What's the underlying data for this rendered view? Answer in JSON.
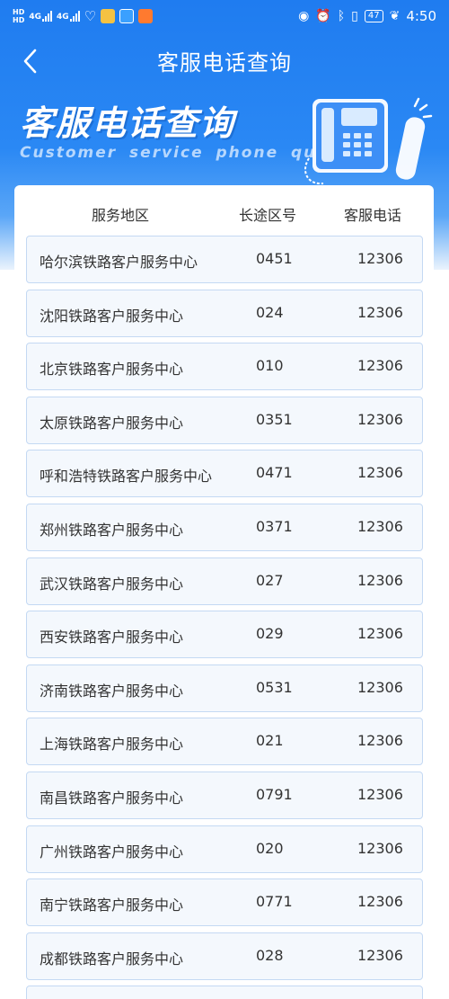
{
  "status_bar": {
    "hd_top": "HD",
    "hd_bottom": "HD",
    "net1": "4G",
    "net2": "4G",
    "battery": "47",
    "time": "4:50"
  },
  "nav": {
    "title": "客服电话查询"
  },
  "banner": {
    "title": "客服电话查询",
    "subtitle": "Customer service phone query"
  },
  "table": {
    "headers": {
      "region": "服务地区",
      "area_code": "长途区号",
      "phone": "客服电话"
    },
    "rows": [
      {
        "region": "哈尔滨铁路客户服务中心",
        "area_code": "0451",
        "phone": "12306"
      },
      {
        "region": "沈阳铁路客户服务中心",
        "area_code": "024",
        "phone": "12306"
      },
      {
        "region": "北京铁路客户服务中心",
        "area_code": "010",
        "phone": "12306"
      },
      {
        "region": "太原铁路客户服务中心",
        "area_code": "0351",
        "phone": "12306"
      },
      {
        "region": "呼和浩特铁路客户服务中心",
        "area_code": "0471",
        "phone": "12306"
      },
      {
        "region": "郑州铁路客户服务中心",
        "area_code": "0371",
        "phone": "12306"
      },
      {
        "region": "武汉铁路客户服务中心",
        "area_code": "027",
        "phone": "12306"
      },
      {
        "region": "西安铁路客户服务中心",
        "area_code": "029",
        "phone": "12306"
      },
      {
        "region": "济南铁路客户服务中心",
        "area_code": "0531",
        "phone": "12306"
      },
      {
        "region": "上海铁路客户服务中心",
        "area_code": "021",
        "phone": "12306"
      },
      {
        "region": "南昌铁路客户服务中心",
        "area_code": "0791",
        "phone": "12306"
      },
      {
        "region": "广州铁路客户服务中心",
        "area_code": "020",
        "phone": "12306"
      },
      {
        "region": "南宁铁路客户服务中心",
        "area_code": "0771",
        "phone": "12306"
      },
      {
        "region": "成都铁路客户服务中心",
        "area_code": "028",
        "phone": "12306"
      },
      {
        "region": "",
        "area_code": "",
        "phone": ""
      }
    ]
  },
  "colors": {
    "header_blue": "#1f7cf0",
    "row_bg": "#f4f8fd",
    "row_border": "#c4d9f3"
  },
  "icons": {
    "back": "chevron-left-icon",
    "phone_illustration": "desk-phone-icon"
  }
}
